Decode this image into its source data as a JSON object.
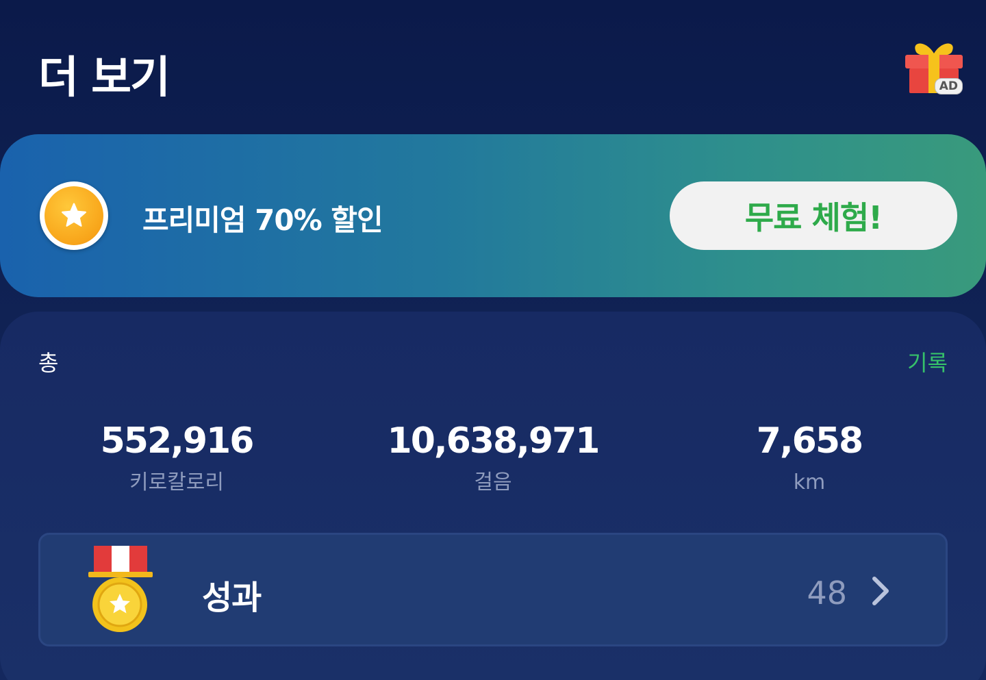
{
  "header": {
    "title": "더 보기",
    "gift_badge": "AD"
  },
  "premium": {
    "text": "프리미엄 70% 할인",
    "button_label": "무료 체험!"
  },
  "summary": {
    "total_label": "총",
    "history_link": "기록",
    "stats": {
      "calories": {
        "value": "552,916",
        "label": "키로칼로리"
      },
      "steps": {
        "value": "10,638,971",
        "label": "걸음"
      },
      "distance": {
        "value": "7,658",
        "label": "km"
      }
    }
  },
  "achievements": {
    "label": "성과",
    "count": "48"
  },
  "colors": {
    "accent_green": "#36c16a",
    "background": "#0b1a4a",
    "card": "#172a63"
  },
  "icons": [
    "gift-icon",
    "star-coin-icon",
    "medal-icon",
    "chevron-right-icon"
  ]
}
